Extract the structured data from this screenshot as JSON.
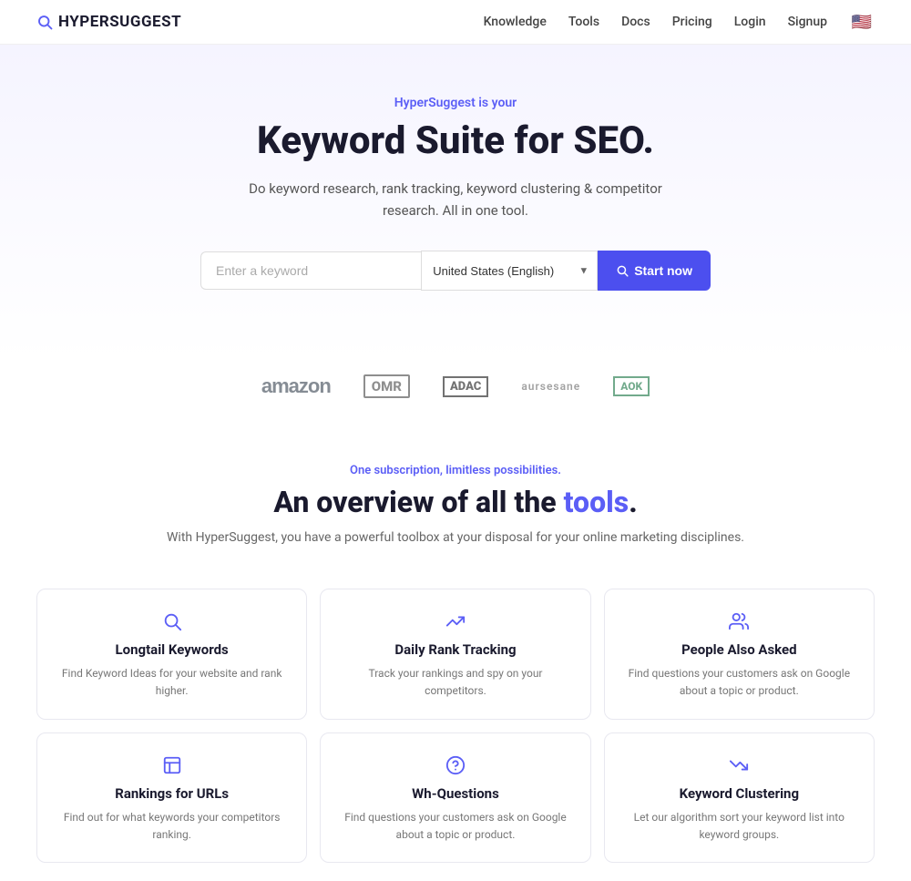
{
  "nav": {
    "logo": "HYPERSUGGEST",
    "links": [
      "Knowledge",
      "Tools",
      "Docs",
      "Pricing",
      "Login",
      "Signup"
    ],
    "flag": "🇺🇸"
  },
  "hero": {
    "tag": "HyperSuggest is your",
    "title_start": "Keyword Suite for SEO.",
    "subtitle_line1": "Do keyword research, rank tracking, keyword clustering & competitor",
    "subtitle_line2": "research. All in one tool.",
    "search_placeholder": "Enter a keyword",
    "search_country": "United States (English)",
    "search_button": "Start now"
  },
  "tools": {
    "tag": "One subscription, limitless possibilities.",
    "title_start": "An overview of all the ",
    "title_accent": "tools",
    "title_end": ".",
    "desc": "With HyperSuggest, you have a powerful toolbox at your disposal for your online marketing disciplines."
  },
  "cards": [
    {
      "id": "longtail",
      "title": "Longtail Keywords",
      "desc": "Find Keyword Ideas for your website and rank higher."
    },
    {
      "id": "rank-tracking",
      "title": "Daily Rank Tracking",
      "desc": "Track your rankings and spy on your competitors."
    },
    {
      "id": "people-also-asked",
      "title": "People Also Asked",
      "desc": "Find questions your customers ask on Google about a topic or product."
    },
    {
      "id": "rankings-urls",
      "title": "Rankings for URLs",
      "desc": "Find out for what keywords your competitors ranking."
    },
    {
      "id": "wh-questions",
      "title": "Wh-Questions",
      "desc": "Find questions your customers ask on Google about a topic or product."
    },
    {
      "id": "keyword-clustering",
      "title": "Keyword Clustering",
      "desc": "Let our algorithm sort your keyword list into keyword groups."
    }
  ],
  "logos": [
    "amazon",
    "OMR",
    "ADAC",
    "aursesane",
    "AOK"
  ]
}
